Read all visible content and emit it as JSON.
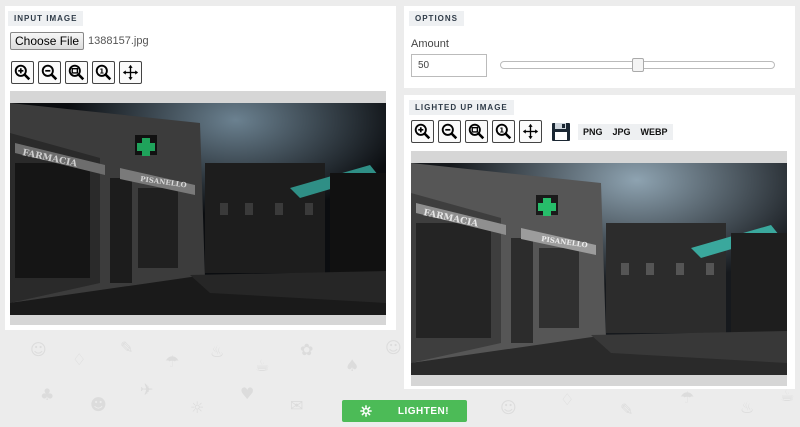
{
  "input_panel": {
    "section_label": "INPUT IMAGE",
    "choose_file_label": "Choose File",
    "file_name": "1388157.jpg",
    "toolbar": [
      "zoom-in-icon",
      "zoom-out-icon",
      "zoom-fit-icon",
      "zoom-actual-icon",
      "move-icon"
    ]
  },
  "options_panel": {
    "section_label": "OPTIONS",
    "amount_label": "Amount",
    "amount_value": "50",
    "slider_value_percent": 50
  },
  "output_panel": {
    "section_label": "LIGHTED UP IMAGE",
    "toolbar": [
      "zoom-in-icon",
      "zoom-out-icon",
      "zoom-fit-icon",
      "zoom-actual-icon",
      "move-icon"
    ],
    "save_icon": "floppy-disk-icon",
    "formats": [
      "PNG",
      "JPG",
      "WEBP"
    ]
  },
  "action": {
    "lighten_label": "LIGHTEN!",
    "icon": "gear-icon"
  },
  "photo_text": {
    "sign_farmacia": "FARMACIA",
    "sign_pisanello": "PISANELLO"
  },
  "colors": {
    "accent_green": "#4cbb57",
    "tag_bg": "#eef0f2",
    "awning_teal": "#2f8f86",
    "pharmacy_cross": "#1fa35b"
  }
}
